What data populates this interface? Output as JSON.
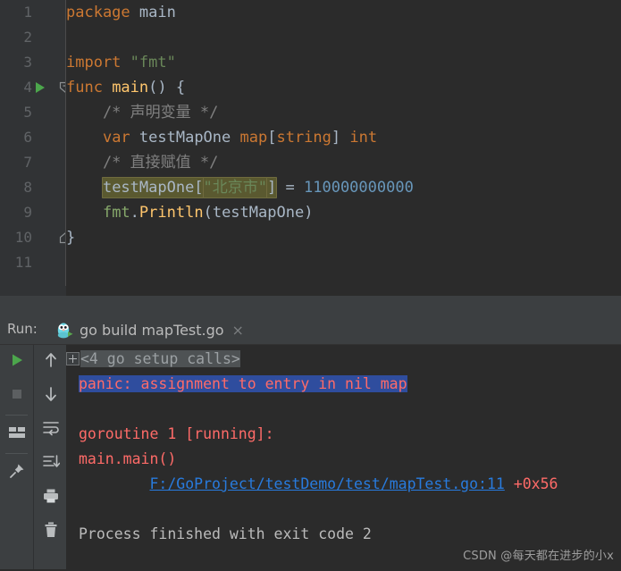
{
  "editor": {
    "lines": [
      {
        "no": "1",
        "tokens": [
          {
            "t": "package ",
            "c": "kw"
          },
          {
            "t": "main",
            "c": "ident"
          }
        ]
      },
      {
        "no": "2",
        "tokens": []
      },
      {
        "no": "3",
        "tokens": [
          {
            "t": "import ",
            "c": "kw"
          },
          {
            "t": "\"fmt\"",
            "c": "str"
          }
        ]
      },
      {
        "no": "4",
        "tokens": [
          {
            "t": "func ",
            "c": "kw"
          },
          {
            "t": "main",
            "c": "fn"
          },
          {
            "t": "() {",
            "c": "plain"
          }
        ]
      },
      {
        "no": "5",
        "tokens": [
          {
            "t": "    /* 声明变量 */",
            "c": "cmt"
          }
        ]
      },
      {
        "no": "6",
        "tokens": [
          {
            "t": "    ",
            "c": "plain"
          },
          {
            "t": "var ",
            "c": "kw"
          },
          {
            "t": "testMapOne ",
            "c": "ident"
          },
          {
            "t": "map",
            "c": "kw"
          },
          {
            "t": "[",
            "c": "plain"
          },
          {
            "t": "string",
            "c": "kw"
          },
          {
            "t": "] ",
            "c": "plain"
          },
          {
            "t": "int",
            "c": "kw"
          }
        ]
      },
      {
        "no": "7",
        "tokens": [
          {
            "t": "    /* 直接赋值 */",
            "c": "cmt"
          }
        ]
      },
      {
        "no": "8",
        "tokens": [
          {
            "t": "    ",
            "c": "plain"
          },
          {
            "t": "testMapOne[",
            "c": "ident",
            "hl": true
          },
          {
            "t": "\"北京市\"",
            "c": "str",
            "hl": true
          },
          {
            "t": "]",
            "c": "plain",
            "hl": true
          },
          {
            "t": " = ",
            "c": "plain"
          },
          {
            "t": "110000000000",
            "c": "num"
          }
        ]
      },
      {
        "no": "9",
        "tokens": [
          {
            "t": "    ",
            "c": "plain"
          },
          {
            "t": "fmt",
            "c": "pkgref"
          },
          {
            "t": ".",
            "c": "plain"
          },
          {
            "t": "Println",
            "c": "fn"
          },
          {
            "t": "(",
            "c": "plain"
          },
          {
            "t": "testMapOne",
            "c": "ident"
          },
          {
            "t": ")",
            "c": "plain"
          }
        ]
      },
      {
        "no": "10",
        "tokens": [
          {
            "t": "}",
            "c": "plain"
          }
        ]
      },
      {
        "no": "11",
        "tokens": []
      }
    ],
    "run_gutter_line": "4",
    "bulb_tooltip": "intention-bulb",
    "highlight_row": "3"
  },
  "run_panel": {
    "label": "Run:",
    "tab_title": "go build mapTest.go",
    "tab_close": "×",
    "toolbar_left": [
      {
        "name": "rerun-button",
        "icon": "play-icon"
      },
      {
        "name": "stop-button",
        "icon": "stop-icon"
      },
      {
        "name": "layout-button",
        "icon": "layout-icon"
      },
      {
        "name": "pin-tab-button",
        "icon": "pin-icon"
      }
    ],
    "toolbar_right": [
      {
        "name": "prev-occurrence-button",
        "icon": "arrow-up-icon"
      },
      {
        "name": "next-occurrence-button",
        "icon": "arrow-down-icon"
      },
      {
        "name": "soft-wrap-button",
        "icon": "soft-wrap-icon"
      },
      {
        "name": "scroll-to-end-button",
        "icon": "scroll-end-icon"
      },
      {
        "name": "print-button",
        "icon": "printer-icon"
      },
      {
        "name": "clear-all-button",
        "icon": "trash-icon"
      }
    ],
    "console": {
      "fold_text": "<4 go setup calls>",
      "panic_text": "panic: assignment to entry in nil map",
      "blank1": "",
      "goroutine_text": "goroutine 1 [running]:",
      "main_text": "main.main()",
      "trace_link": "F:/GoProject/testDemo/test/mapTest.go:11",
      "trace_offset": " +0x56",
      "blank2": "",
      "finished_text": "Process finished with exit code 2"
    }
  },
  "watermark": "CSDN @每天都在进步的小x",
  "colors": {
    "editor_bg": "#2b2b2b",
    "gutter_bg": "#313335",
    "panel_bg": "#3c3f41",
    "keyword": "#cc7832",
    "string": "#6a8759",
    "number": "#6897bb",
    "comment": "#808080",
    "function": "#ffc66d",
    "identifier": "#a9b7c6",
    "error": "#ff6b68",
    "link": "#287bde",
    "selection": "#2f4d9e",
    "ident_highlight": "#5a5930"
  }
}
